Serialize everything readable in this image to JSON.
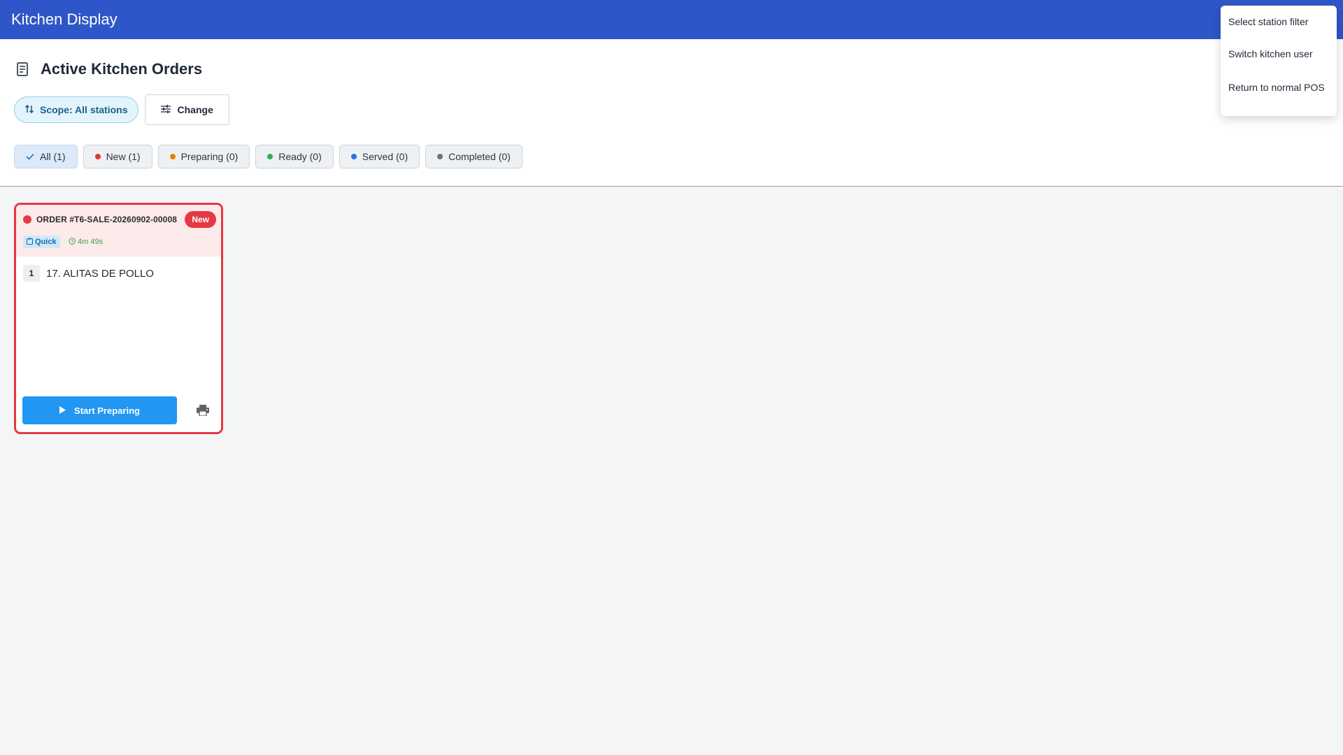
{
  "app": {
    "title": "Kitchen Display"
  },
  "page": {
    "title": "Active Kitchen Orders",
    "title_icon": "receipt-icon"
  },
  "scope": {
    "label": "Scope: All stations",
    "change_label": "Change"
  },
  "filters": [
    {
      "label": "All (1)",
      "active": true,
      "icon": "check-icon"
    },
    {
      "label": "New (1)",
      "dot": "#e53935"
    },
    {
      "label": "Preparing (0)",
      "dot": "#f57c00"
    },
    {
      "label": "Ready (0)",
      "dot": "#2bb24c"
    },
    {
      "label": "Served (0)",
      "dot": "#2f6fe0"
    },
    {
      "label": "Completed (0)",
      "dot": "#6b7280"
    }
  ],
  "order": {
    "title": "ORDER #T6-SALE-20260902-00008",
    "status_badge": "New",
    "type_badge": "Quick",
    "elapsed": "4m 49s",
    "items": [
      {
        "qty": "1",
        "name": "17. ALITAS  DE POLLO"
      }
    ],
    "start_label": "Start Preparing"
  },
  "menu": {
    "items": [
      "Select station filter",
      "Switch kitchen user",
      "Return to normal POS"
    ]
  },
  "colors": {
    "appbar": "#2f56c8",
    "new_status": "#e53945",
    "primary_button": "#2196f3"
  }
}
